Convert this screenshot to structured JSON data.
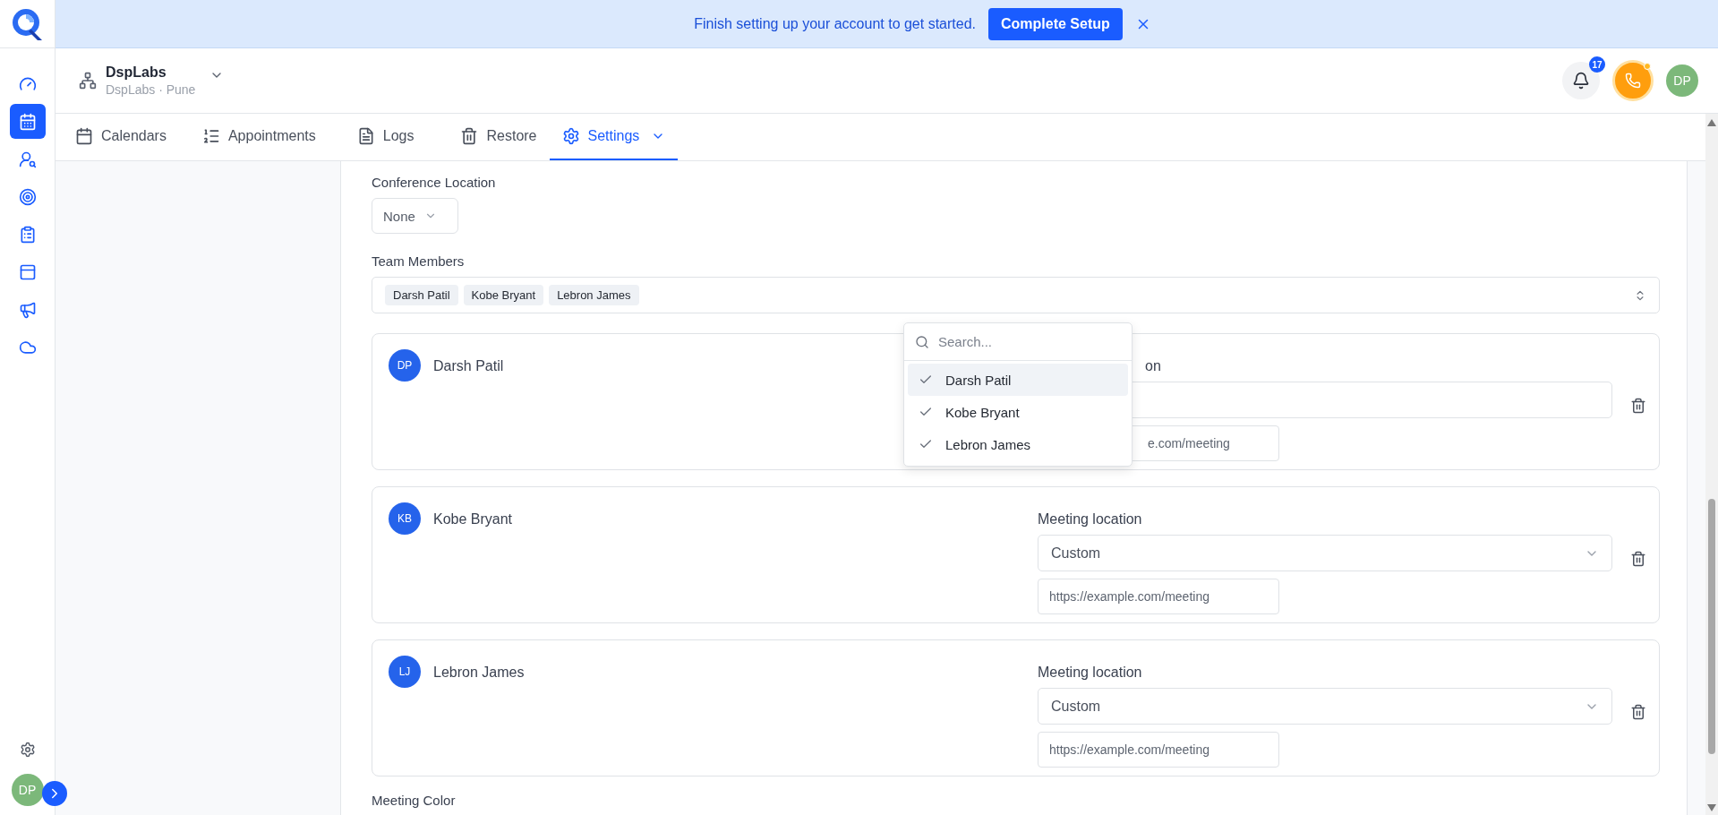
{
  "banner": {
    "message": "Finish setting up your account to get started.",
    "button": "Complete Setup"
  },
  "sidebar": {
    "items": [
      {
        "selected": false
      },
      {
        "selected": true
      },
      {
        "selected": false
      },
      {
        "selected": false
      },
      {
        "selected": false
      },
      {
        "selected": false
      },
      {
        "selected": false
      },
      {
        "selected": false
      }
    ],
    "avatar": "DP"
  },
  "header": {
    "org_name": "DspLabs",
    "org_sub": "DspLabs · Pune",
    "notifications": "17",
    "avatar": "DP"
  },
  "tabs": [
    {
      "label": "Calendars",
      "selected": false
    },
    {
      "label": "Appointments",
      "selected": false
    },
    {
      "label": "Logs",
      "selected": false
    },
    {
      "label": "Restore",
      "selected": false
    },
    {
      "label": "Settings",
      "selected": true
    }
  ],
  "form": {
    "conference_label": "Conference Location",
    "conference_value": "None",
    "team_label": "Team Members",
    "team_members": [
      "Darsh Patil",
      "Kobe Bryant",
      "Lebron James"
    ]
  },
  "members": [
    {
      "initials": "DP",
      "name": "Darsh Patil",
      "location_label": "on",
      "url_placeholder": "e.com/meeting",
      "covered": true
    },
    {
      "initials": "KB",
      "name": "Kobe Bryant",
      "location_label": "Meeting location",
      "location": "Custom",
      "url_placeholder": "https://example.com/meeting",
      "covered": false
    },
    {
      "initials": "LJ",
      "name": "Lebron James",
      "location_label": "Meeting location",
      "location": "Custom",
      "url_placeholder": "https://example.com/meeting",
      "covered": false
    }
  ],
  "dropdown": {
    "placeholder": "Search...",
    "options": [
      {
        "label": "Darsh Patil",
        "checked": true,
        "highlighted": true
      },
      {
        "label": "Kobe Bryant",
        "checked": true,
        "highlighted": false
      },
      {
        "label": "Lebron James",
        "checked": true,
        "highlighted": false
      }
    ]
  },
  "next_section": "Meeting Color"
}
